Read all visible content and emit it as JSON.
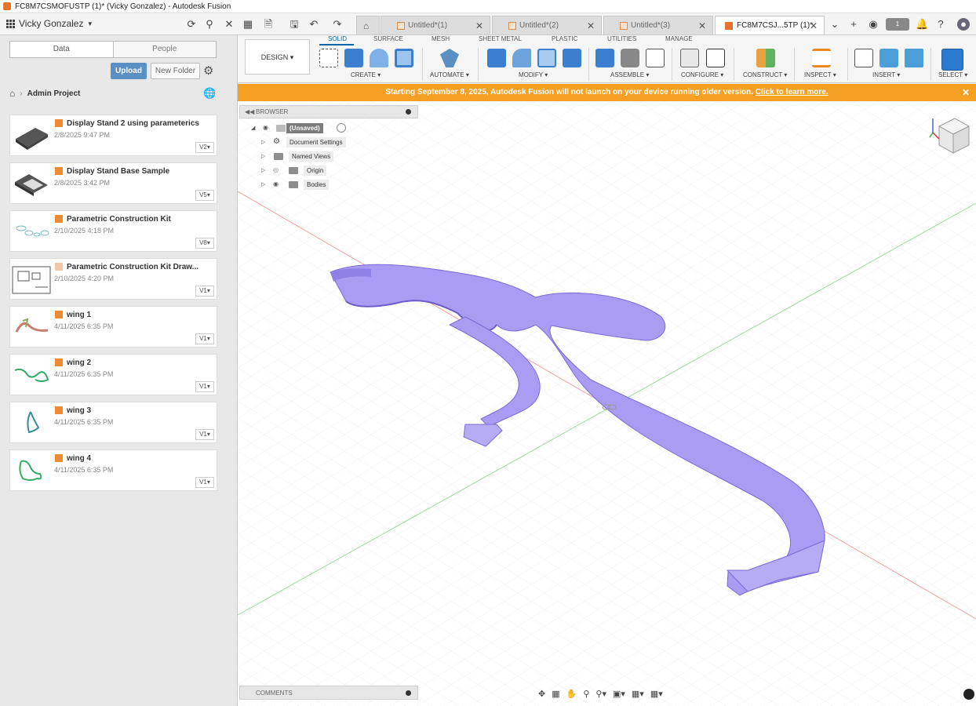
{
  "window": {
    "title": "FC8M7CSMOFUSTP (1)* (Vicky Gonzalez) - Autodesk Fusion"
  },
  "appbar": {
    "user": "Vicky Gonzalez",
    "tabs": [
      {
        "label": "Untitled*(1)",
        "active": false
      },
      {
        "label": "Untitled*(2)",
        "active": false
      },
      {
        "label": "Untitled*(3)",
        "active": false
      },
      {
        "label": "FC8M7CSJ...5TP (1)*",
        "active": true
      }
    ],
    "notification_count": "1"
  },
  "datapanel": {
    "seg_data": "Data",
    "seg_people": "People",
    "upload": "Upload",
    "new_folder": "New Folder",
    "breadcrumb": "Admin Project",
    "files": [
      {
        "name": "Display Stand 2 using parameterics",
        "date": "2/8/2025 9:47 PM",
        "version": "V2"
      },
      {
        "name": "Display Stand Base Sample",
        "date": "2/8/2025 3:42 PM",
        "version": "V5"
      },
      {
        "name": "Parametric Construction Kit",
        "date": "2/10/2025 4:18 PM",
        "version": "V8"
      },
      {
        "name": "Parametric Construction Kit Draw...",
        "date": "2/10/2025 4:20 PM",
        "version": "V1"
      },
      {
        "name": "wing 1",
        "date": "4/11/2025 6:35 PM",
        "version": "V1"
      },
      {
        "name": "wing 2",
        "date": "4/11/2025 6:35 PM",
        "version": "V1"
      },
      {
        "name": "wing 3",
        "date": "4/11/2025 6:35 PM",
        "version": "V1"
      },
      {
        "name": "wing 4",
        "date": "4/11/2025 6:35 PM",
        "version": "V1"
      }
    ]
  },
  "toolbar": {
    "workspace": "DESIGN ▾",
    "tabs": [
      "SOLID",
      "SURFACE",
      "MESH",
      "SHEET METAL",
      "PLASTIC",
      "UTILITIES",
      "MANAGE"
    ],
    "groups": [
      "CREATE ▾",
      "AUTOMATE ▾",
      "MODIFY ▾",
      "ASSEMBLE ▾",
      "CONFIGURE ▾",
      "CONSTRUCT ▾",
      "INSPECT ▾",
      "INSERT ▾",
      "SELECT ▾"
    ]
  },
  "banner": {
    "text": "Starting September 8, 2025, Autodesk Fusion will not launch on your device running older version. ",
    "link": "Click to learn more."
  },
  "browser": {
    "title": "BROWSER",
    "root": "(Unsaved)",
    "items": [
      "Document Settings",
      "Named Views",
      "Origin",
      "Bodies"
    ]
  },
  "comments": {
    "title": "COMMENTS"
  },
  "colors": {
    "accent": "#0a65a8",
    "banner": "#f5a023",
    "body": "#a89cf0",
    "upload": "#5a8fc4"
  }
}
